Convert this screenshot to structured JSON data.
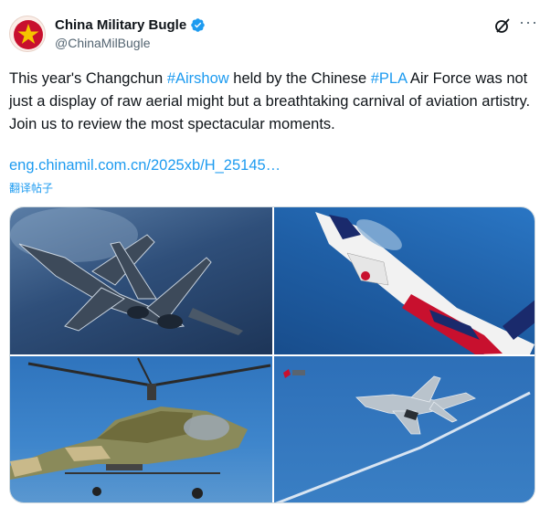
{
  "author": {
    "name": "China Military Bugle",
    "handle": "@ChinaMilBugle",
    "verified_icon": "verified-badge-icon",
    "accent": "#1d9bf0"
  },
  "post": {
    "text_part1": "This year's Changchun ",
    "hashtag1": "#Airshow",
    "text_part2": " held by the Chinese ",
    "hashtag2": "#PLA",
    "text_part3": " Air Force was not just a display of raw aerial might but a breathtaking carnival of aviation artistry. Join us to review the most spectacular moments.",
    "link": "eng.chinamil.com.cn/2025xb/H_25145…",
    "translate": "翻译帖子"
  },
  "actions": {
    "grok_icon": "grok-icon",
    "more_label": "···"
  },
  "media": [
    {
      "subject": "fighter jets in formation"
    },
    {
      "subject": "aerobatic jet with red white blue livery"
    },
    {
      "subject": "attack helicopter"
    },
    {
      "subject": "stealth fighter with smoke trail"
    }
  ]
}
